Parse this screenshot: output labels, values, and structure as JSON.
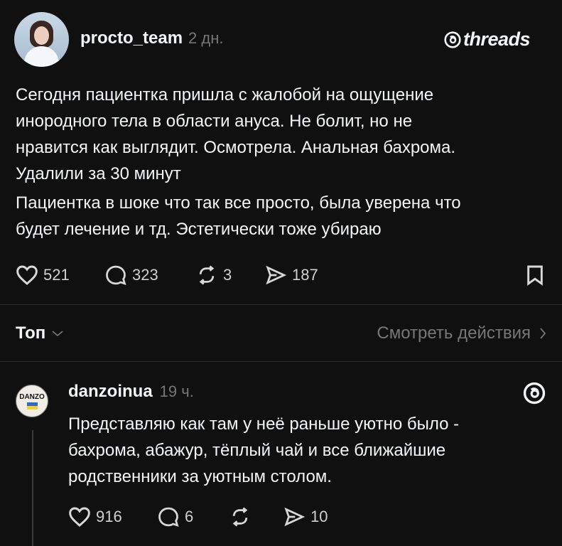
{
  "post": {
    "username": "procto_team",
    "time": "2 дн.",
    "brand": "threads",
    "paragraph1_lines": [
      "Сегодня пациентка пришла с жалобой на ощущение",
      "инородного тела в области ануса. Не болит, но не",
      "нравится как выглядит. Осмотрела. Анальная бахрома.",
      "Удалили за 30 минут"
    ],
    "paragraph2_lines": [
      "Пациентка в шоке что так все просто, была уверена что",
      "будет лечение и тд. Эстетически тоже убираю"
    ],
    "likes": "521",
    "comments": "323",
    "reposts": "3",
    "shares": "187"
  },
  "sort": {
    "label": "Топ",
    "view_activity": "Смотреть действия"
  },
  "reply": {
    "avatar_text": "DANZO",
    "username": "danzoinua",
    "time": "19 ч.",
    "lines": [
      "Представляю как там у неё раньше уютно было -",
      "бахрома, абажур, тёплый чай и все ближайшие",
      "родственники за уютным столом."
    ],
    "likes": "916",
    "comments": "6",
    "shares": "10"
  },
  "icons": [
    "heart-icon",
    "comment-icon",
    "repost-icon",
    "share-icon",
    "bookmark-icon",
    "chevron-down-icon",
    "chevron-right-icon",
    "threads-logo-icon"
  ]
}
